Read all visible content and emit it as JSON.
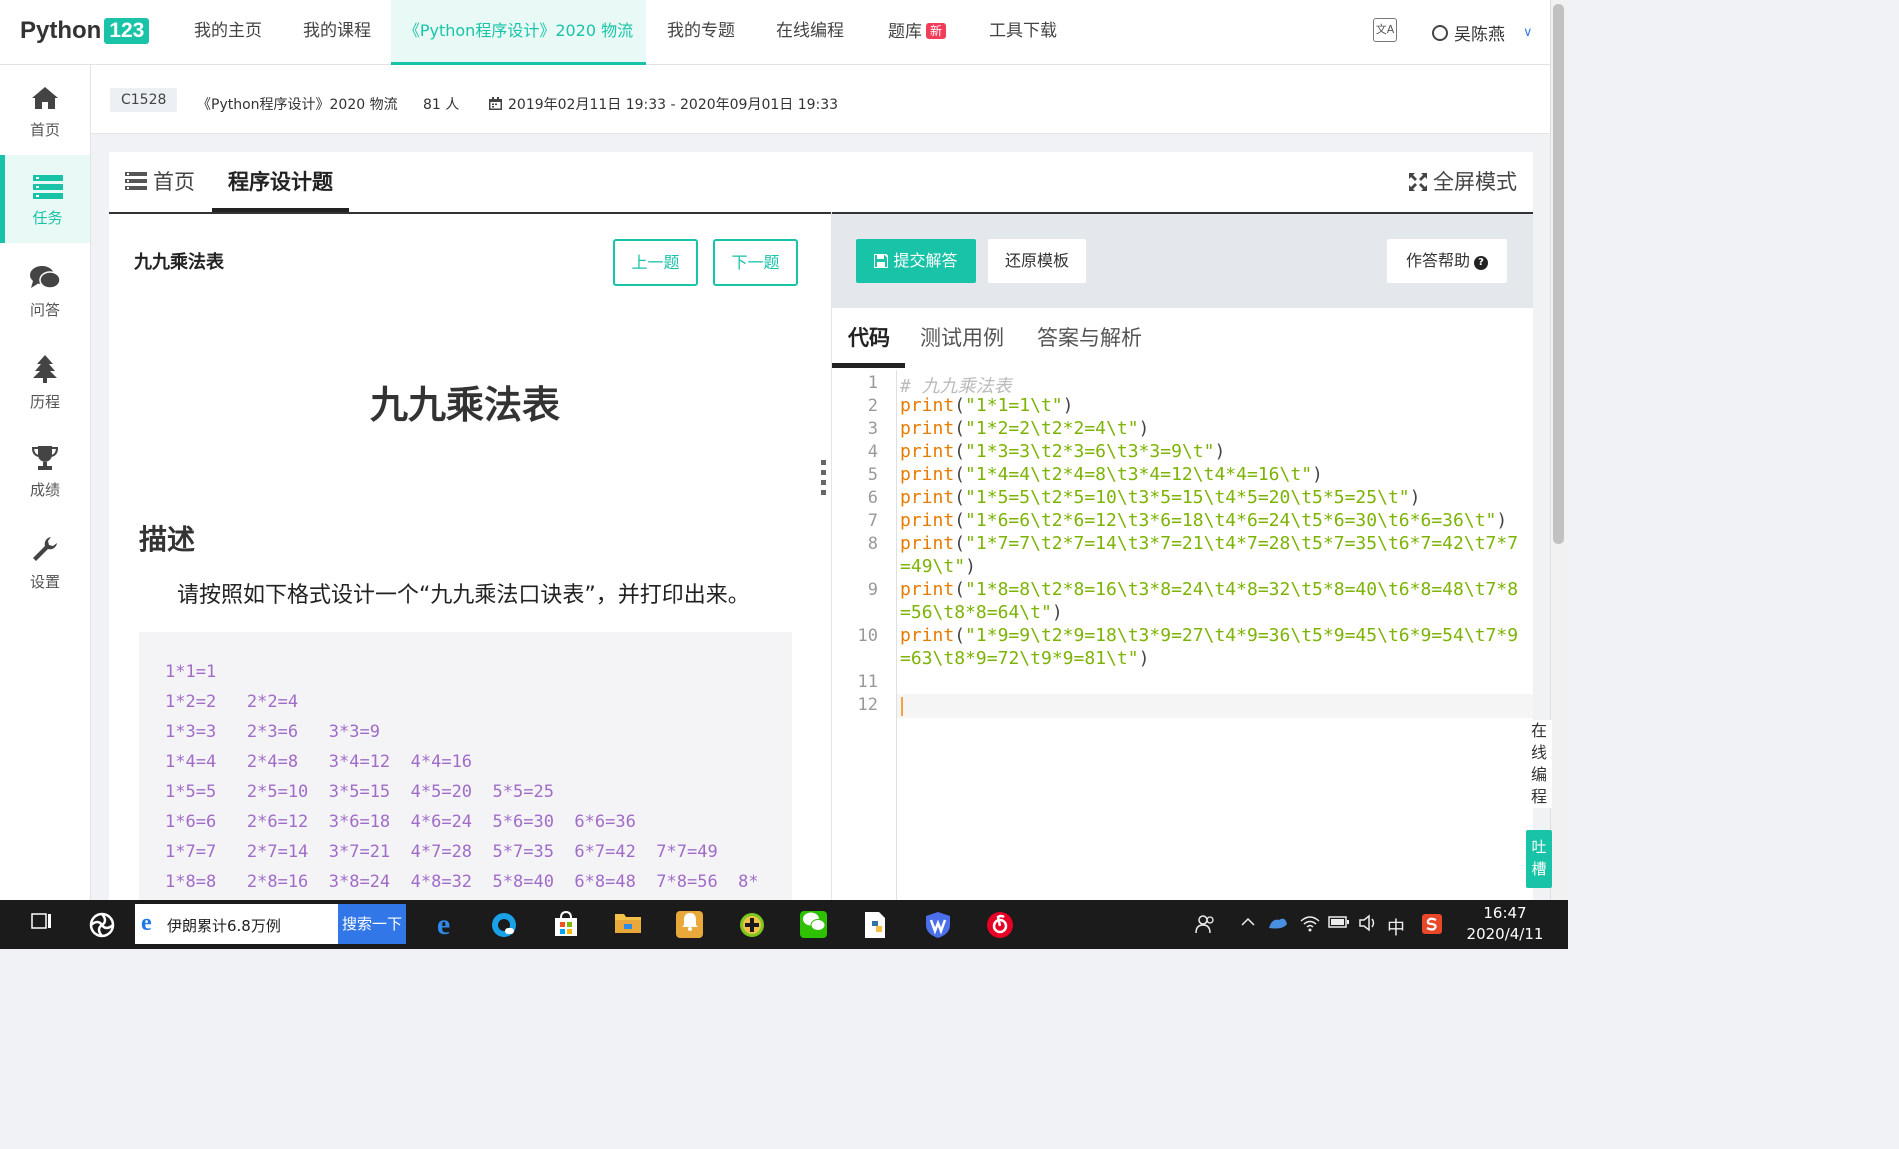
{
  "topnav": {
    "logo_text": "Python",
    "logo_badge": "123",
    "items": [
      {
        "label": "我的主页"
      },
      {
        "label": "我的课程"
      },
      {
        "label": "《Python程序设计》2020 物流"
      },
      {
        "label": "我的专题"
      },
      {
        "label": "在线编程"
      },
      {
        "label": "题库",
        "badge": "新"
      },
      {
        "label": "工具下载"
      }
    ],
    "user_name": "吴陈燕",
    "accent": "#19c3a8"
  },
  "sidebar": {
    "items": [
      {
        "label": "首页",
        "icon": "home-icon"
      },
      {
        "label": "任务",
        "icon": "tasks-icon"
      },
      {
        "label": "问答",
        "icon": "comments-icon"
      },
      {
        "label": "历程",
        "icon": "tree-icon"
      },
      {
        "label": "成绩",
        "icon": "trophy-icon"
      },
      {
        "label": "设置",
        "icon": "wrench-icon"
      }
    ]
  },
  "course": {
    "code": "C1528",
    "name": "《Python程序设计》2020 物流",
    "count": "81 人",
    "date_range": "2019年02月11日 19:33 - 2020年09月01日 19:33"
  },
  "tabs": {
    "home": "首页",
    "programming": "程序设计题",
    "fullscreen": "全屏模式"
  },
  "problem": {
    "title": "九九乘法表",
    "prev": "上一题",
    "next": "下一题",
    "heading": "九九乘法表",
    "desc_heading": "描述",
    "description": "请按照如下格式设计一个“九九乘法口诀表”，并打印出来。",
    "sample_lines": [
      "1*1=1",
      "1*2=2   2*2=4",
      "1*3=3   2*3=6   3*3=9",
      "1*4=4   2*4=8   3*4=12  4*4=16",
      "1*5=5   2*5=10  3*5=15  4*5=20  5*5=25",
      "1*6=6   2*6=12  3*6=18  4*6=24  5*6=30  6*6=36",
      "1*7=7   2*7=14  3*7=21  4*7=28  5*7=35  6*7=42  7*7=49",
      "1*8=8   2*8=16  3*8=24  4*8=32  5*8=40  6*8=48  7*8=56  8*"
    ]
  },
  "editor": {
    "submit": "提交解答",
    "restore": "还原模板",
    "help": "作答帮助",
    "tabs": [
      "代码",
      "测试用例",
      "答案与解析"
    ],
    "line_numbers": [
      "1",
      "2",
      "3",
      "4",
      "5",
      "6",
      "7",
      "8",
      "9",
      "10",
      "11",
      "12"
    ],
    "code_lines": [
      "# 九九乘法表",
      "print(\"1*1=1\\t\")",
      "print(\"1*2=2\\t2*2=4\\t\")",
      "print(\"1*3=3\\t2*3=6\\t3*3=9\\t\")",
      "print(\"1*4=4\\t2*4=8\\t3*4=12\\t4*4=16\\t\")",
      "print(\"1*5=5\\t2*5=10\\t3*5=15\\t4*5=20\\t5*5=25\\t\")",
      "print(\"1*6=6\\t2*6=12\\t3*6=18\\t4*6=24\\t5*6=30\\t6*6=36\\t\")",
      "print(\"1*7=7\\t2*7=14\\t3*7=21\\t4*7=28\\t5*7=35\\t6*7=42\\t7*7",
      "=49\\t\")",
      "print(\"1*8=8\\t2*8=16\\t3*8=24\\t4*8=32\\t5*8=40\\t6*8=48\\t7*8",
      "=56\\t8*8=64\\t\")",
      "print(\"1*9=9\\t2*9=18\\t3*9=27\\t4*9=36\\t5*9=45\\t6*9=54\\t7*9",
      "=63\\t8*9=72\\t9*9=81\\t\")"
    ]
  },
  "floating": {
    "online_coding": [
      "在",
      "线",
      "编",
      "程"
    ],
    "tucao": [
      "吐",
      "槽"
    ]
  },
  "taskbar": {
    "search_text": "伊朗累计6.8万例",
    "search_button": "搜索一下",
    "ime": "中",
    "time": "16:47",
    "date": "2020/4/11"
  }
}
